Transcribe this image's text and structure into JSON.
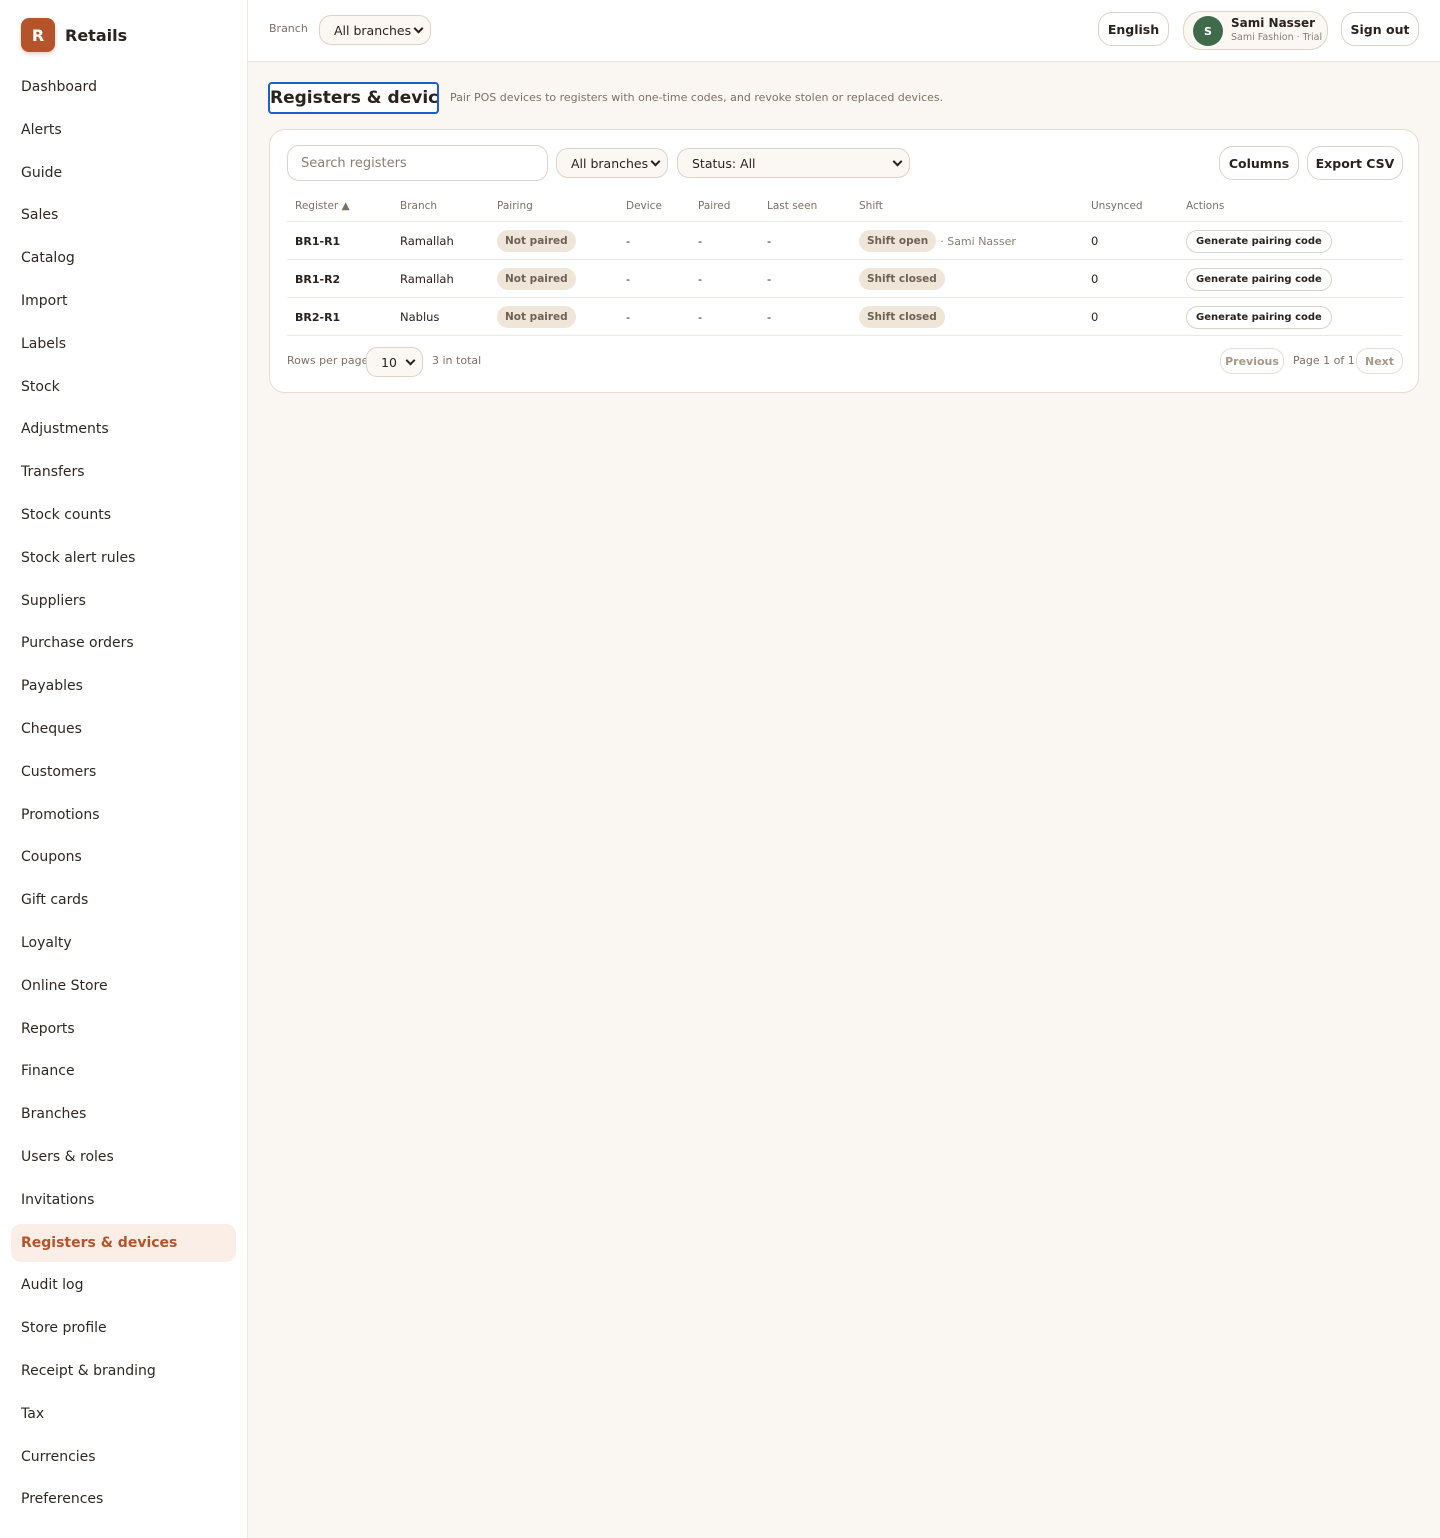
{
  "brand": {
    "initial": "R",
    "name": "Retails"
  },
  "sidebar": {
    "items": [
      {
        "label": "Dashboard"
      },
      {
        "label": "Alerts"
      },
      {
        "label": "Guide"
      },
      {
        "label": "Sales"
      },
      {
        "label": "Catalog"
      },
      {
        "label": "Import"
      },
      {
        "label": "Labels"
      },
      {
        "label": "Stock"
      },
      {
        "label": "Adjustments"
      },
      {
        "label": "Transfers"
      },
      {
        "label": "Stock counts"
      },
      {
        "label": "Stock alert rules"
      },
      {
        "label": "Suppliers"
      },
      {
        "label": "Purchase orders"
      },
      {
        "label": "Payables"
      },
      {
        "label": "Cheques"
      },
      {
        "label": "Customers"
      },
      {
        "label": "Promotions"
      },
      {
        "label": "Coupons"
      },
      {
        "label": "Gift cards"
      },
      {
        "label": "Loyalty"
      },
      {
        "label": "Online Store"
      },
      {
        "label": "Reports"
      },
      {
        "label": "Finance"
      },
      {
        "label": "Branches"
      },
      {
        "label": "Users & roles"
      },
      {
        "label": "Invitations"
      },
      {
        "label": "Registers & devices",
        "active": true
      },
      {
        "label": "Audit log"
      },
      {
        "label": "Store profile"
      },
      {
        "label": "Receipt & branding"
      },
      {
        "label": "Tax"
      },
      {
        "label": "Currencies"
      },
      {
        "label": "Preferences"
      }
    ]
  },
  "topbar": {
    "branch_label": "Branch",
    "branch_value": "All branches",
    "language": "English",
    "user": {
      "initial": "S",
      "name": "Sami Nasser",
      "subtitle": "Sami Fashion · Trial"
    },
    "sign_out": "Sign out"
  },
  "page": {
    "title": "Registers & devices",
    "description": "Pair POS devices to registers with one-time codes, and revoke stolen or replaced devices."
  },
  "toolbar": {
    "search_placeholder": "Search registers",
    "branch_filter": "All branches",
    "status_filter": "Status: All",
    "columns": "Columns",
    "export": "Export CSV"
  },
  "table": {
    "headers": {
      "register": "Register ▲",
      "branch": "Branch",
      "pairing": "Pairing",
      "device": "Device",
      "paired": "Paired",
      "last_seen": "Last seen",
      "shift": "Shift",
      "unsynced": "Unsynced",
      "actions": "Actions"
    },
    "rows": [
      {
        "register": "BR1-R1",
        "branch": "Ramallah",
        "pairing": "Not paired",
        "device": "-",
        "paired": "-",
        "last_seen": "-",
        "shift": "Shift open",
        "shift_user": "· Sami Nasser",
        "unsynced": "0",
        "action": "Generate pairing code"
      },
      {
        "register": "BR1-R2",
        "branch": "Ramallah",
        "pairing": "Not paired",
        "device": "-",
        "paired": "-",
        "last_seen": "-",
        "shift": "Shift closed",
        "shift_user": "",
        "unsynced": "0",
        "action": "Generate pairing code"
      },
      {
        "register": "BR2-R1",
        "branch": "Nablus",
        "pairing": "Not paired",
        "device": "-",
        "paired": "-",
        "last_seen": "-",
        "shift": "Shift closed",
        "shift_user": "",
        "unsynced": "0",
        "action": "Generate pairing code"
      }
    ]
  },
  "pagination": {
    "rows_per_page_label": "Rows per page",
    "rows_per_page": "10",
    "total": "3 in total",
    "previous": "Previous",
    "page_info": "Page 1 of 1",
    "next": "Next"
  }
}
